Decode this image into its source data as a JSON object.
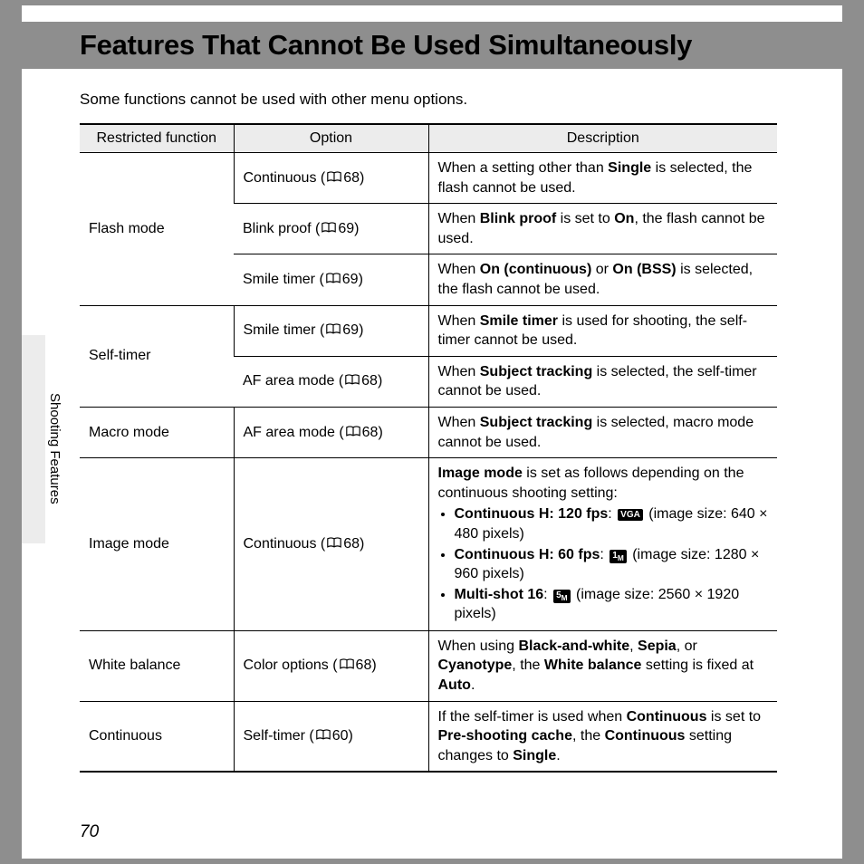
{
  "title": "Features That Cannot Be Used Simultaneously",
  "intro": "Some functions cannot be used with other menu options.",
  "sideLabel": "Shooting Features",
  "pageNum": "70",
  "headers": {
    "func": "Restricted function",
    "option": "Option",
    "desc": "Description"
  },
  "rows": [
    {
      "func": "Flash mode",
      "funcRowspan": 3,
      "option": "Continuous",
      "ref": "68",
      "desc": "When a setting other than <b>Single</b> is selected, the flash cannot be used."
    },
    {
      "option": "Blink proof",
      "ref": "69",
      "desc": "When <b>Blink proof</b> is set to <b>On</b>, the flash cannot be used."
    },
    {
      "option": "Smile timer",
      "ref": "69",
      "desc": "When <b>On (continuous)</b> or <b>On (BSS)</b> is selected, the flash cannot be used."
    },
    {
      "func": "Self-timer",
      "funcRowspan": 2,
      "option": "Smile timer",
      "ref": "69",
      "desc": "When <b>Smile timer</b> is used for shooting, the self-timer cannot be used."
    },
    {
      "option": "AF area mode",
      "ref": "68",
      "desc": "When <b>Subject tracking</b> is selected, the self-timer cannot be used."
    },
    {
      "func": "Macro mode",
      "funcRowspan": 1,
      "option": "AF area mode",
      "ref": "68",
      "desc": "When <b>Subject tracking</b> is selected, macro mode cannot be used."
    },
    {
      "func": "Image mode",
      "funcRowspan": 1,
      "option": "Continuous",
      "ref": "68",
      "desc": "<b>Image mode</b> is set as follows depending on the continuous shooting setting:<ul><li><b>Continuous H: 120 fps</b>: <span class=\"glyph\">VGA</span> (image size: 640 × 480 pixels)</li><li><b>Continuous H: 60 fps</b>: <span class=\"glyph\">1<sub>M</sub></span> (image size: 1280 × 960 pixels)</li><li><b>Multi-shot 16</b>: <span class=\"glyph\">5<sub>M</sub></span> (image size: 2560 × 1920 pixels)</li></ul>"
    },
    {
      "func": "White balance",
      "funcRowspan": 1,
      "option": "Color options",
      "ref": "68",
      "desc": "When using <b>Black-and-white</b>, <b>Sepia</b>, or <b>Cyanotype</b>, the <b>White balance</b> setting is fixed at <b>Auto</b>."
    },
    {
      "func": "Continuous",
      "funcRowspan": 1,
      "option": "Self-timer",
      "ref": "60",
      "desc": "If the self-timer is used when <b>Continuous</b> is set to <b>Pre-shooting cache</b>, the <b>Continuous</b> setting changes to <b>Single</b>."
    }
  ]
}
